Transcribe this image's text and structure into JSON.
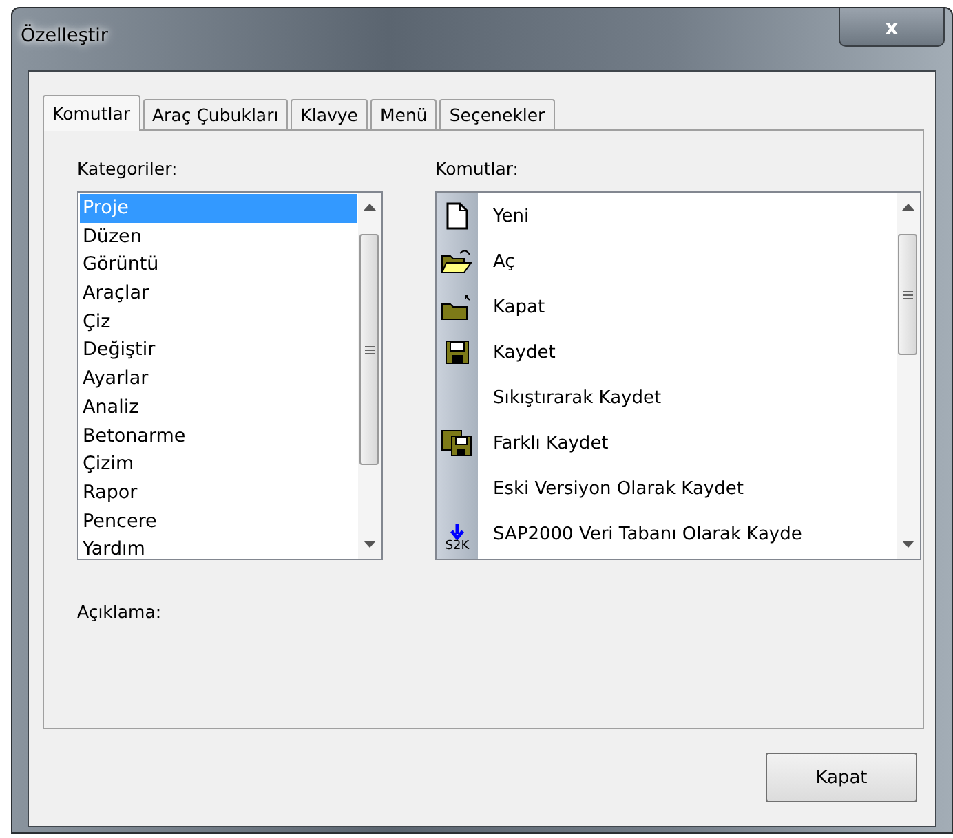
{
  "window": {
    "title": "Özelleştir",
    "close": "x"
  },
  "tabs": [
    {
      "label": "Komutlar",
      "selected": true
    },
    {
      "label": "Araç Çubukları",
      "selected": false
    },
    {
      "label": "Klavye",
      "selected": false
    },
    {
      "label": "Menü",
      "selected": false
    },
    {
      "label": "Seçenekler",
      "selected": false
    }
  ],
  "categories": {
    "label": "Kategoriler:",
    "items": [
      {
        "label": "Proje",
        "selected": true
      },
      {
        "label": "Düzen",
        "selected": false
      },
      {
        "label": "Görüntü",
        "selected": false
      },
      {
        "label": "Araçlar",
        "selected": false
      },
      {
        "label": "Çiz",
        "selected": false
      },
      {
        "label": "Değiştir",
        "selected": false
      },
      {
        "label": "Ayarlar",
        "selected": false
      },
      {
        "label": "Analiz",
        "selected": false
      },
      {
        "label": "Betonarme",
        "selected": false
      },
      {
        "label": "Çizim",
        "selected": false
      },
      {
        "label": "Rapor",
        "selected": false
      },
      {
        "label": "Pencere",
        "selected": false
      },
      {
        "label": "Yardım",
        "selected": false
      }
    ]
  },
  "commands": {
    "label": "Komutlar:",
    "items": [
      {
        "label": "Yeni",
        "kind": "new"
      },
      {
        "label": "Aç",
        "kind": "open"
      },
      {
        "label": "Kapat",
        "kind": "close"
      },
      {
        "label": "Kaydet",
        "kind": "save"
      },
      {
        "label": "Sıkıştırarak Kaydet",
        "kind": "plain"
      },
      {
        "label": "Farklı Kaydet",
        "kind": "saveas"
      },
      {
        "label": "Eski Versiyon Olarak Kaydet",
        "kind": "plain"
      },
      {
        "label": "SAP2000 Veri Tabanı Olarak Kayde",
        "kind": "s2k",
        "icon_text": "S2K"
      }
    ]
  },
  "description": {
    "label": "Açıklama:"
  },
  "buttons": [
    "Kapat"
  ]
}
